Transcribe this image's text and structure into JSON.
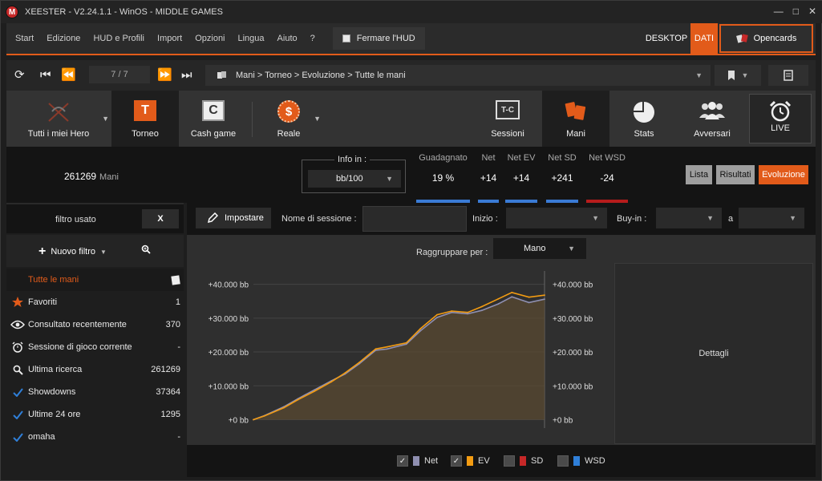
{
  "titlebar": {
    "logo": "M",
    "title": "XEESTER - V2.24.1.1 - WinOS - MIDDLE GAMES"
  },
  "menu": {
    "items": [
      "Start",
      "Edizione",
      "HUD e Profili",
      "Import",
      "Opzioni",
      "Lingua",
      "Aiuto",
      "?"
    ],
    "hud_label": "Fermare l'HUD",
    "desktop": "DESKTOP",
    "dati": "DATI",
    "opencards": "Opencards"
  },
  "nav": {
    "counter": "7 / 7",
    "breadcrumb": "Mani > Torneo > Evoluzione > Tutte le mani"
  },
  "toolbar": {
    "hero": "Tutti i miei Hero",
    "torneo": "Torneo",
    "torneo_glyph": "T",
    "cash": "Cash game",
    "cash_glyph": "C",
    "reale": "Reale",
    "reale_glyph": "$",
    "sessioni": "Sessioni",
    "sessioni_glyph": "T-C",
    "mani": "Mani",
    "stats": "Stats",
    "avversari": "Avversari",
    "live": "LIVE"
  },
  "stats": {
    "hands_value": "261269",
    "hands_label": "Mani",
    "info_label": "Info in :",
    "info_value": "bb/100",
    "items": [
      {
        "label": "Guadagnato",
        "value": "19 %",
        "color": "#3a7bd5"
      },
      {
        "label": "Net",
        "value": "+14",
        "color": "#3a7bd5"
      },
      {
        "label": "Net EV",
        "value": "+14",
        "color": "#3a7bd5"
      },
      {
        "label": "Net SD",
        "value": "+241",
        "color": "#3a7bd5"
      },
      {
        "label": "Net WSD",
        "value": "-24",
        "color": "#b71c1c"
      }
    ],
    "btn_lista": "Lista",
    "btn_risultati": "Risultati",
    "btn_evoluzione": "Evoluzione"
  },
  "left": {
    "filtro_label": "filtro usato",
    "filtro_x": "X",
    "nuovo_filtro": "Nuovo filtro",
    "header": "Tutte le mani",
    "items": [
      {
        "label": "Favoriti",
        "count": "1",
        "icon": "star-icon"
      },
      {
        "label": "Consultato recentemente",
        "count": "370",
        "icon": "eye-icon"
      },
      {
        "label": "Sessione di gioco corrente",
        "count": "-",
        "icon": "alarm-clock-icon"
      },
      {
        "label": "Ultima ricerca",
        "count": "261269",
        "icon": "search-icon"
      },
      {
        "label": "Showdowns",
        "count": "37364",
        "icon": "check-icon"
      },
      {
        "label": "Ultime 24 ore",
        "count": "1295",
        "icon": "check-icon"
      },
      {
        "label": "omaha",
        "count": "-",
        "icon": "check-icon"
      }
    ]
  },
  "filterbar": {
    "impostare": "Impostare",
    "session_label": "Nome di sessione :",
    "inizio_label": "Inizio :",
    "buyin_label": "Buy-in :",
    "a_label": "a"
  },
  "chartarea": {
    "raggruppare_label": "Raggruppare per :",
    "raggruppare_value": "Mano",
    "dettagli": "Dettagli"
  },
  "chart_data": {
    "type": "line",
    "x_ticks": [
      "0",
      "27249",
      "54759",
      "82269",
      "109779",
      "137289",
      "164799",
      "192309",
      "219819",
      "247329"
    ],
    "y_ticks": [
      "+0 bb",
      "+10.000 bb",
      "+20.000 bb",
      "+30.000 bb",
      "+40.000 bb"
    ],
    "ylim": [
      -2500,
      43000
    ],
    "xlim": [
      0,
      261269
    ],
    "series": [
      {
        "name": "Net",
        "color": "#8f8fb0",
        "x": [
          0,
          10000,
          27249,
          40000,
          54759,
          70000,
          82269,
          95000,
          109779,
          120000,
          137289,
          150000,
          164799,
          178000,
          192309,
          205000,
          219819,
          232000,
          247329,
          261269
        ],
        "y": [
          0,
          1200,
          3800,
          6200,
          8800,
          11500,
          13500,
          16500,
          20500,
          20900,
          22300,
          26300,
          30200,
          31700,
          31300,
          32300,
          34200,
          36300,
          34600,
          35600
        ]
      },
      {
        "name": "EV",
        "color": "#f39c12",
        "x": [
          0,
          10000,
          27249,
          40000,
          54759,
          70000,
          82269,
          95000,
          109779,
          120000,
          137289,
          150000,
          164799,
          178000,
          192309,
          205000,
          219819,
          232000,
          247329,
          261269
        ],
        "y": [
          0,
          1100,
          3500,
          5900,
          8400,
          11200,
          13800,
          16900,
          20900,
          21500,
          22700,
          26900,
          31000,
          32100,
          31700,
          33400,
          35700,
          37600,
          36200,
          36800
        ]
      }
    ]
  },
  "legend": [
    {
      "label": "Net",
      "checked": true,
      "color": "#8f8fb0"
    },
    {
      "label": "EV",
      "checked": true,
      "color": "#f39c12"
    },
    {
      "label": "SD",
      "checked": false,
      "color": "#c62828"
    },
    {
      "label": "WSD",
      "checked": false,
      "color": "#2f7fd8"
    }
  ]
}
